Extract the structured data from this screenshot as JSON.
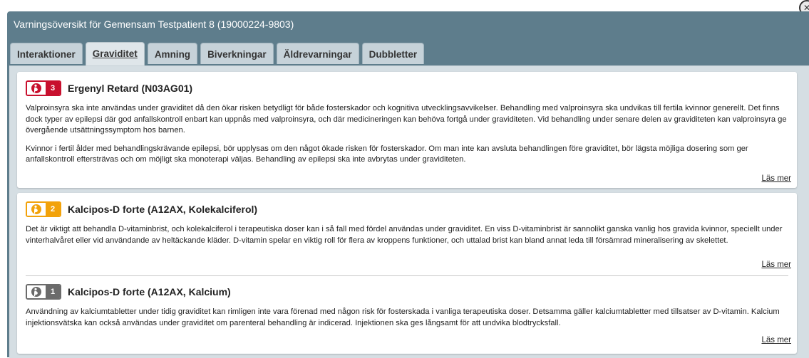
{
  "window": {
    "title": "Varningsöversikt för Gemensam Testpatient 8 (19000224-9803)"
  },
  "tabs": [
    {
      "label": "Interaktioner",
      "active": false
    },
    {
      "label": "Graviditet",
      "active": true
    },
    {
      "label": "Amning",
      "active": false
    },
    {
      "label": "Biverkningar",
      "active": false
    },
    {
      "label": "Äldrevarningar",
      "active": false
    },
    {
      "label": "Dubbletter",
      "active": false
    }
  ],
  "colors": {
    "level3": "#c8102e",
    "level2": "#f2a20a",
    "level1": "#6b6b6b"
  },
  "warnings": [
    {
      "icon": "pregnancy-icon",
      "level": "3",
      "name": "Ergenyl Retard (N03AG01)",
      "paragraphs": [
        "Valproinsyra ska inte användas under graviditet då den ökar risken betydligt för både fosterskador och kognitiva utvecklingsavvikelser. Behandling med valproinsyra ska undvikas till fertila kvinnor generellt. Det finns dock typer av epilepsi där god anfallskontroll enbart kan uppnås med valproinsyra, och där medicineringen kan behöva fortgå under graviditeten. Vid behandling under senare delen av graviditeten kan valproinsyra ge övergående utsättningssymptom hos barnen.",
        "Kvinnor i fertil ålder med behandlingskrävande epilepsi, bör upplysas om den något ökade risken för fosterskador. Om man inte kan avsluta behandlingen före graviditet, bör lägsta möjliga dosering som ger anfallskontroll eftersträvas och om möjligt ska monoterapi väljas. Behandling av epilepsi ska inte avbrytas under graviditeten."
      ],
      "read_more": "Läs mer"
    },
    {
      "icon": "pregnancy-icon",
      "level": "2",
      "name": "Kalcipos-D forte (A12AX, Kolekalciferol)",
      "paragraphs": [
        "Det är viktigt att behandla D-vitaminbrist, och kolekalciferol i terapeutiska doser kan i så fall med fördel användas under graviditet. En viss D-vitaminbrist är sannolikt ganska vanlig hos gravida kvinnor, speciellt under vinterhalvåret eller vid användande av heltäckande kläder. D-vitamin spelar en viktig roll för flera av kroppens funktioner, och uttalad brist kan bland annat leda till försämrad mineralisering av skelettet."
      ],
      "read_more": "Läs mer"
    },
    {
      "icon": "pregnancy-icon",
      "level": "1",
      "name": "Kalcipos-D forte (A12AX, Kalcium)",
      "paragraphs": [
        "Användning av kalciumtabletter under tidig graviditet kan rimligen inte vara förenad med någon risk för fosterskada i vanliga terapeutiska doser. Detsamma gäller kalciumtabletter med tillsatser av D-vitamin. Kalcium injektionsvätska kan också användas under graviditet om parenteral behandling är indicerad. Injektionen ska ges långsamt för att undvika blodtrycksfall."
      ],
      "read_more": "Läs mer"
    }
  ]
}
